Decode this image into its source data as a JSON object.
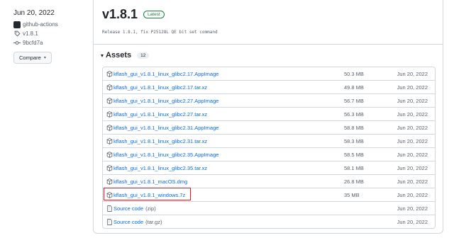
{
  "sidebar": {
    "date": "Jun 20, 2022",
    "author": "github-actions",
    "tag": "v1.8.1",
    "commit": "9bcfd7a",
    "compare_label": "Compare"
  },
  "release": {
    "title": "v1.8.1",
    "badge": "Latest",
    "description": "Release 1.8.1, fix P25128L QE bit set command"
  },
  "assets": {
    "label": "Assets",
    "count": "12",
    "items": [
      {
        "name": "kflash_gui_v1.8.1_linux_glibc2.17.AppImage",
        "size": "50.3 MB",
        "date": "Jun 20, 2022"
      },
      {
        "name": "kflash_gui_v1.8.1_linux_glibc2.17.tar.xz",
        "size": "49.8 MB",
        "date": "Jun 20, 2022"
      },
      {
        "name": "kflash_gui_v1.8.1_linux_glibc2.27.AppImage",
        "size": "56.7 MB",
        "date": "Jun 20, 2022"
      },
      {
        "name": "kflash_gui_v1.8.1_linux_glibc2.27.tar.xz",
        "size": "56.3 MB",
        "date": "Jun 20, 2022"
      },
      {
        "name": "kflash_gui_v1.8.1_linux_glibc2.31.AppImage",
        "size": "58.8 MB",
        "date": "Jun 20, 2022"
      },
      {
        "name": "kflash_gui_v1.8.1_linux_glibc2.31.tar.xz",
        "size": "58.3 MB",
        "date": "Jun 20, 2022"
      },
      {
        "name": "kflash_gui_v1.8.1_linux_glibc2.35.AppImage",
        "size": "58.5 MB",
        "date": "Jun 20, 2022"
      },
      {
        "name": "kflash_gui_v1.8.1_linux_glibc2.35.tar.xz",
        "size": "58.1 MB",
        "date": "Jun 20, 2022"
      },
      {
        "name": "kflash_gui_v1.8.1_macOS.dmg",
        "size": "26.8 MB",
        "date": "Jun 20, 2022"
      },
      {
        "name": "kflash_gui_v1.8.1_windows.7z",
        "size": "35 MB",
        "date": "Jun 20, 2022"
      }
    ],
    "source_zip": {
      "name": "Source code",
      "ext": "(zip)",
      "date": "Jun 20, 2022"
    },
    "source_tar": {
      "name": "Source code",
      "ext": "(tar.gz)",
      "date": "Jun 20, 2022"
    }
  },
  "colors": {
    "link": "#0969da",
    "badge_green": "#1a7f37",
    "highlight": "#e3141b"
  },
  "icons": [
    "github-avatar-icon",
    "tag-icon",
    "commit-icon",
    "caret-down-icon",
    "package-icon",
    "file-zip-icon"
  ]
}
